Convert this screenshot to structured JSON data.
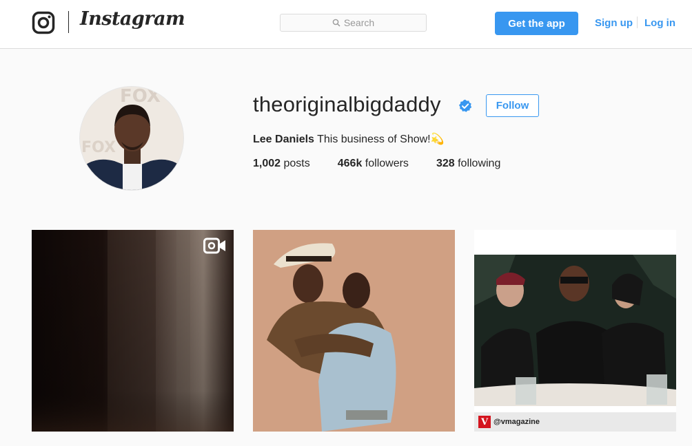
{
  "header": {
    "logo_icon": "instagram-camera-icon",
    "wordmark": "Instagram",
    "search_placeholder": "Search",
    "get_app_label": "Get the app",
    "signup_label": "Sign up",
    "login_label": "Log in"
  },
  "profile": {
    "username": "theoriginalbigdaddy",
    "verified_icon": "verified-badge-icon",
    "follow_label": "Follow",
    "full_name": "Lee Daniels",
    "bio_text": "This business of Show!💫",
    "stats": {
      "posts_count": "1,002",
      "posts_label": "posts",
      "followers_count": "466k",
      "followers_label": "followers",
      "following_count": "328",
      "following_label": "following"
    }
  },
  "posts": [
    {
      "type": "video",
      "icon": "video-camera-icon"
    },
    {
      "type": "photo"
    },
    {
      "type": "photo",
      "caption": "@vmagazine",
      "caption_logo": "V"
    }
  ],
  "colors": {
    "accent": "#3897f0",
    "background": "#fafafa",
    "text": "#262626",
    "border": "#dbdbdb"
  }
}
